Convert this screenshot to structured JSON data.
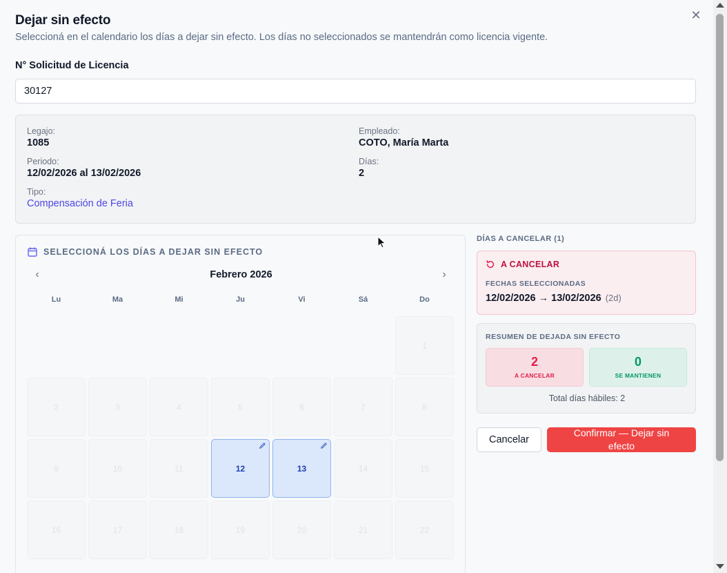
{
  "modal": {
    "title": "Dejar sin efecto",
    "subtitle": "Seleccioná en el calendario los días a dejar sin efecto. Los días no seleccionados se mantendrán como licencia vigente.",
    "close_icon": "close-icon"
  },
  "request": {
    "label": "N° Solicitud de Licencia",
    "value": "30127"
  },
  "info": {
    "legajo_label": "Legajo:",
    "legajo": "1085",
    "empleado_label": "Empleado:",
    "empleado": "COTO, María Marta",
    "periodo_label": "Periodo:",
    "periodo": "12/02/2026 al 13/02/2026",
    "dias_label": "Días:",
    "dias": "2",
    "tipo_label": "Tipo:",
    "tipo": "Compensación de Feria"
  },
  "calendar": {
    "heading": "SELECCIONÁ LOS DÍAS A DEJAR SIN EFECTO",
    "month": "Febrero 2026",
    "weekdays": [
      "Lu",
      "Ma",
      "Mi",
      "Ju",
      "Vi",
      "Sá",
      "Do"
    ],
    "days": [
      "1",
      "2",
      "3",
      "4",
      "5",
      "6",
      "7",
      "8",
      "9",
      "10",
      "11",
      "12",
      "13",
      "14",
      "15",
      "16",
      "17",
      "18",
      "19",
      "20",
      "21",
      "22"
    ],
    "selected_days": [
      "12",
      "13"
    ],
    "prev_icon": "chevron-left-icon",
    "next_icon": "chevron-right-icon"
  },
  "side": {
    "title": "DÍAS A CANCELAR (1)",
    "cancel_card": {
      "heading": "A CANCELAR",
      "fechas_label": "FECHAS SELECCIONADAS",
      "range": "12/02/2026 → 13/02/2026",
      "count": "(2d)"
    },
    "summary": {
      "title": "RESUMEN DE DEJADA SIN EFECTO",
      "cancel_num": "2",
      "cancel_label": "A CANCELAR",
      "keep_num": "0",
      "keep_label": "SE MANTIENEN",
      "total": "Total días hábiles: 2"
    }
  },
  "actions": {
    "cancel_label": "Cancelar",
    "confirm_label": "Confirmar — Dejar sin efecto"
  },
  "colors": {
    "accent": "#4f46e5",
    "danger": "#ef4444",
    "danger_text": "#be123c",
    "success": "#059669",
    "selected_day": "#dbe7fb"
  }
}
